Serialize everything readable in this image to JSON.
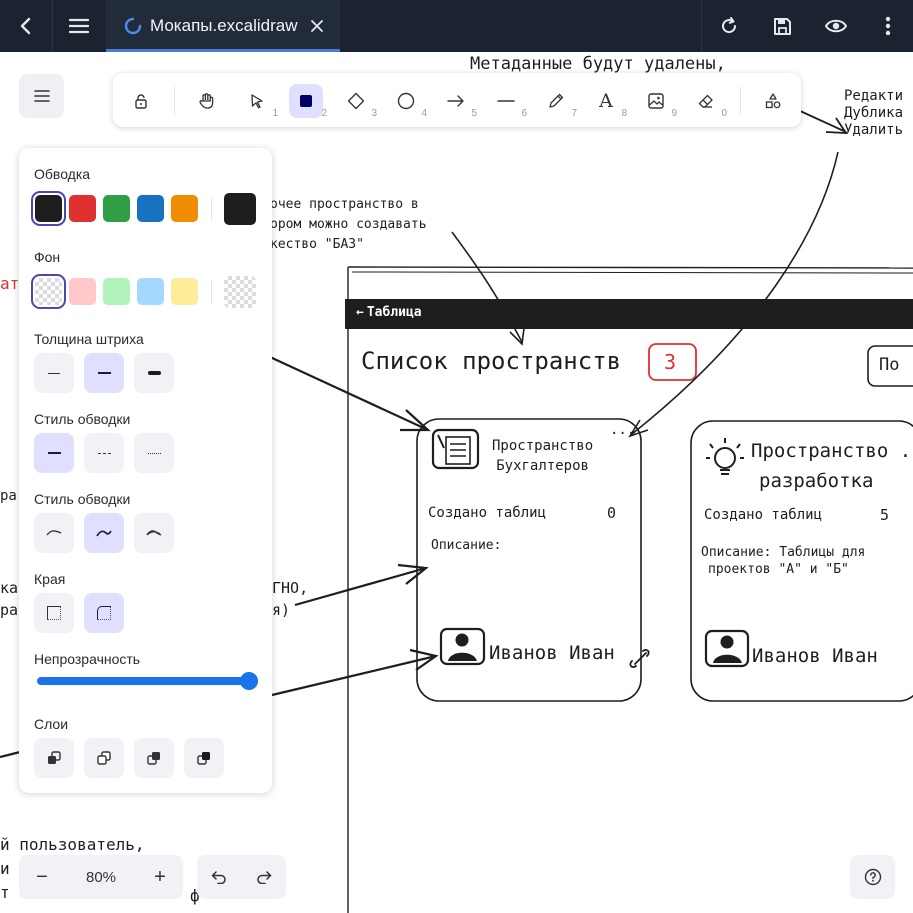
{
  "app_bar": {
    "tab_title": "Мокапы.excalidraw",
    "icons": [
      "back-icon",
      "hamburger-icon",
      "loading-spinner-icon",
      "close-icon",
      "refresh-icon",
      "save-icon",
      "eye-icon",
      "more-vertical-icon"
    ]
  },
  "toolbar": {
    "tools": [
      {
        "name": "lock-icon",
        "num": ""
      },
      {
        "name": "hand-icon",
        "num": ""
      },
      {
        "name": "selection-icon",
        "num": "1"
      },
      {
        "name": "rectangle-icon",
        "num": "2"
      },
      {
        "name": "diamond-icon",
        "num": "3"
      },
      {
        "name": "ellipse-icon",
        "num": "4"
      },
      {
        "name": "arrow-icon",
        "num": "5"
      },
      {
        "name": "line-icon",
        "num": "6"
      },
      {
        "name": "pencil-icon",
        "num": "7"
      },
      {
        "name": "text-icon",
        "num": "8",
        "glyph": "A"
      },
      {
        "name": "image-icon",
        "num": "9"
      },
      {
        "name": "eraser-icon",
        "num": "0"
      },
      {
        "name": "shapes-library-icon",
        "num": ""
      }
    ],
    "active_tool": "rectangle"
  },
  "panel": {
    "stroke_label": "Обводка",
    "stroke_colors": [
      "#1e1e1e",
      "#e03131",
      "#2f9e44",
      "#1971c2",
      "#f08c00"
    ],
    "stroke_current": "#1e1e1e",
    "background_label": "Фон",
    "background_colors": [
      "transparent",
      "#ffc9c9",
      "#b2f2bb",
      "#a5d8ff",
      "#ffec99"
    ],
    "stroke_width_label": "Толщина штриха",
    "stroke_style_label": "Стиль обводки",
    "sloppiness_label": "Стиль обводки",
    "edges_label": "Края",
    "opacity_label": "Непрозрачность",
    "opacity_value": 100,
    "layers_label": "Слои"
  },
  "canvas": {
    "note_top": "Метаданные будут удалены,",
    "note_right": [
      "Редакти",
      "Дублика",
      "Удалить"
    ],
    "note_workspace": [
      "очее пространство в",
      "ором можно создавать",
      "кество \"БАЗ\""
    ],
    "note_left_red": "ат",
    "note_left_1": "ра",
    "note_left_2": [
      "ка",
      "ра"
    ],
    "note_mid": [
      "ГНО,",
      "я)"
    ],
    "note_bottom": [
      "й пользователь,",
      "и",
      "т"
    ],
    "note_bottom_2": "ф",
    "header_bar_label": "Таблица",
    "page_title": "Список пространств",
    "count_badge": "3",
    "right_button_partial": "По",
    "card1": {
      "title_line1": "Пространство",
      "title_line2": "Бухгалтеров",
      "more": "...",
      "tables_label": "Создано таблиц",
      "tables_count": "0",
      "desc_label": "Описание:",
      "owner": "Иванов Иван"
    },
    "card2": {
      "title_line1": "Пространство ...",
      "title_line2": "разработка",
      "tables_label": "Создано таблиц",
      "tables_count": "5",
      "desc_line1": "Описание: Таблицы для",
      "desc_line2": "проектов \"А\" и \"Б\"",
      "owner": "Иванов Иван"
    }
  },
  "bottom": {
    "zoom_value": "80%",
    "zoom_out": "−",
    "zoom_in": "+"
  }
}
